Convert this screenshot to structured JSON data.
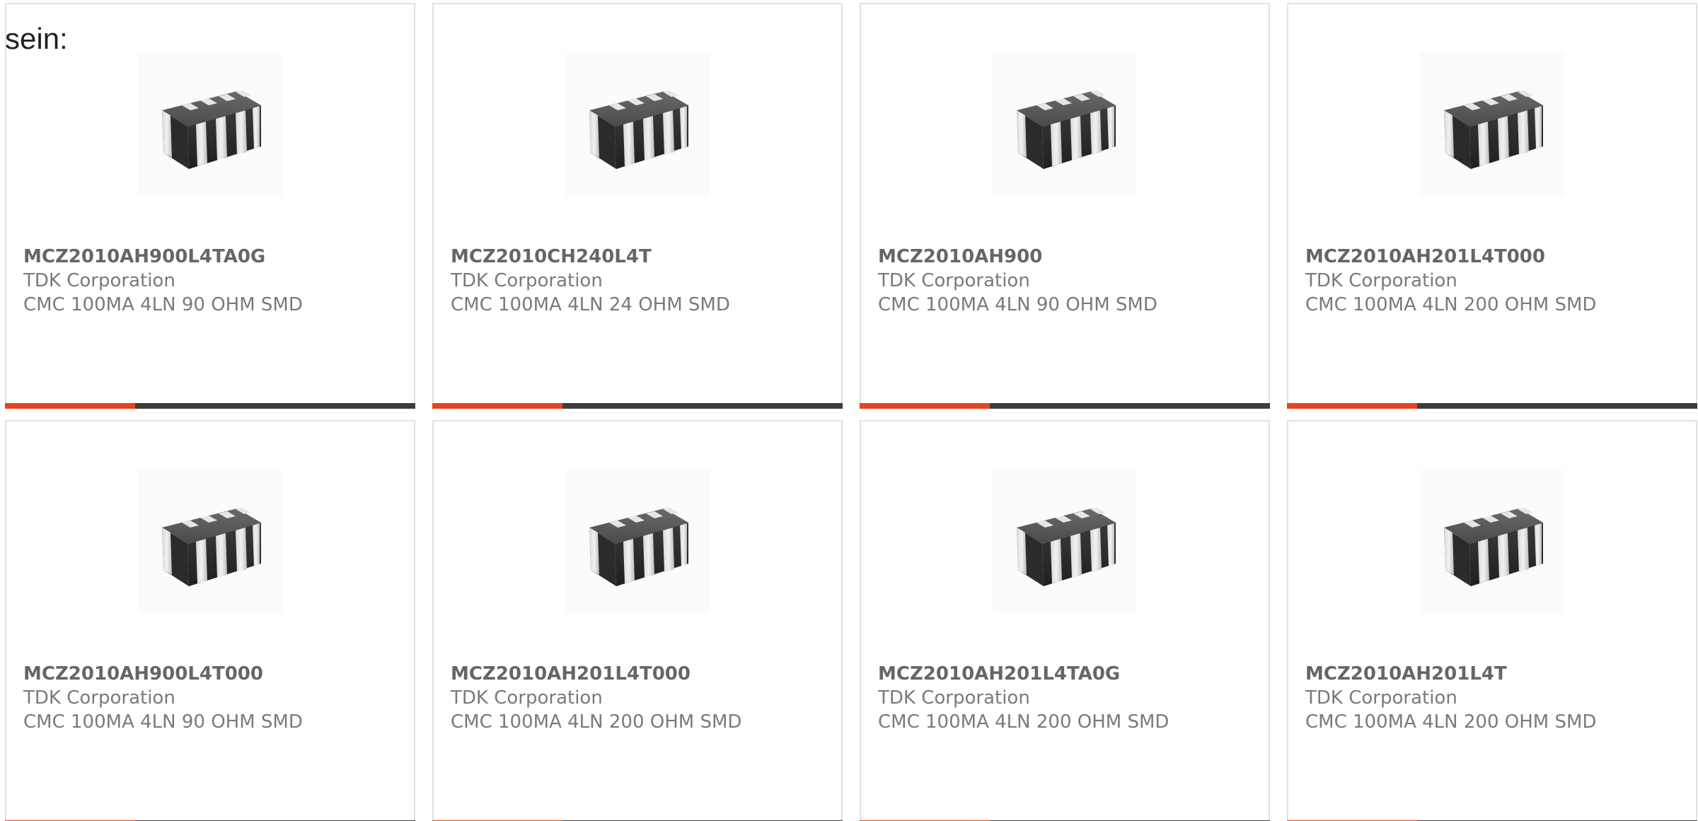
{
  "intro_text": "sein:",
  "colors": {
    "accent": "#e8431e",
    "bar_dark": "#3d3d3d",
    "text_gray": "#7a7a7a"
  },
  "product_image_icon": "smd-common-mode-choke-chip",
  "products": [
    {
      "part": "MCZ2010AH900L4TA0G",
      "manufacturer": "TDK Corporation",
      "description": "CMC 100MA 4LN 90 OHM SMD"
    },
    {
      "part": "MCZ2010CH240L4T",
      "manufacturer": "TDK Corporation",
      "description": "CMC 100MA 4LN 24 OHM SMD"
    },
    {
      "part": "MCZ2010AH900",
      "manufacturer": "TDK Corporation",
      "description": "CMC 100MA 4LN 90 OHM SMD"
    },
    {
      "part": "MCZ2010AH201L4T000",
      "manufacturer": "TDK Corporation",
      "description": "CMC 100MA 4LN 200 OHM SMD"
    },
    {
      "part": "MCZ2010AH900L4T000",
      "manufacturer": "TDK Corporation",
      "description": "CMC 100MA 4LN 90 OHM SMD"
    },
    {
      "part": "MCZ2010AH201L4T000",
      "manufacturer": "TDK Corporation",
      "description": "CMC 100MA 4LN 200 OHM SMD"
    },
    {
      "part": "MCZ2010AH201L4TA0G",
      "manufacturer": "TDK Corporation",
      "description": "CMC 100MA 4LN 200 OHM SMD"
    },
    {
      "part": "MCZ2010AH201L4T",
      "manufacturer": "TDK Corporation",
      "description": "CMC 100MA 4LN 200 OHM SMD"
    }
  ]
}
